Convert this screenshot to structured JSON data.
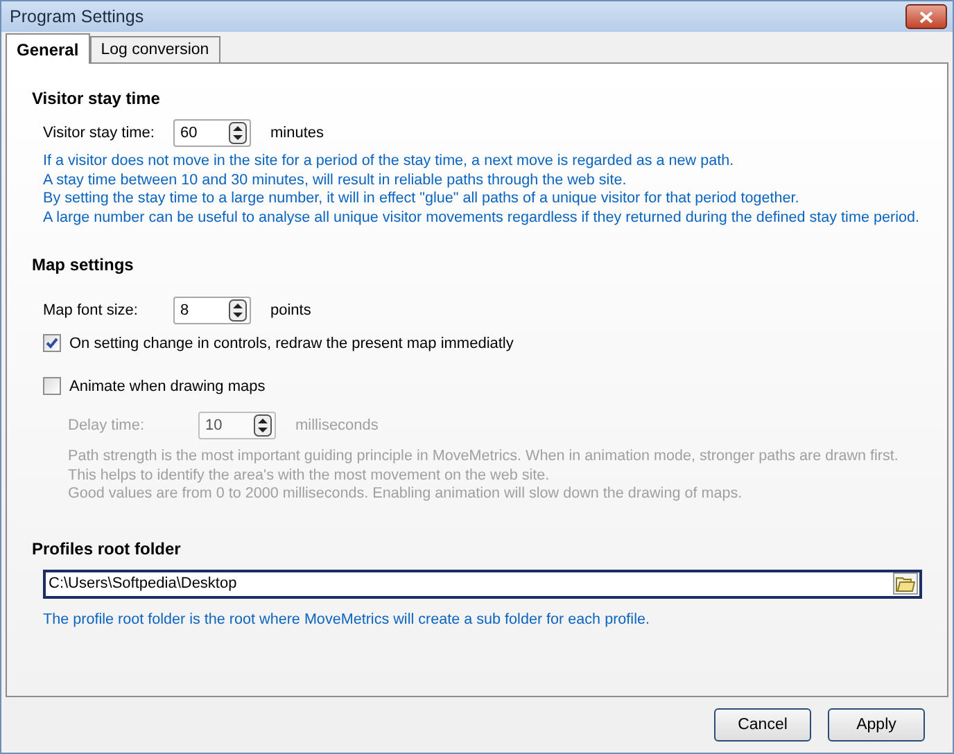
{
  "window": {
    "title": "Program Settings"
  },
  "tabs": [
    {
      "label": "General",
      "selected": true
    },
    {
      "label": "Log conversion",
      "selected": false
    }
  ],
  "visitor_stay_time": {
    "heading": "Visitor stay time",
    "field": {
      "label": "Visitor stay time:",
      "value": "60",
      "unit": "minutes"
    },
    "notes": [
      "If a visitor does not move in the site for a period of the stay time, a next move is regarded as a new path.",
      "A stay time between 10 and 30 minutes, will result in reliable paths through the web site.",
      "By setting the stay time to a large number, it will in effect \"glue\" all paths of a unique visitor for that period together.",
      "A large number can be useful to analyse all unique visitor movements regardless if they returned during the defined stay time period."
    ]
  },
  "map_settings": {
    "heading": "Map settings",
    "font_size": {
      "label": "Map font size:",
      "value": "8",
      "unit": "points"
    },
    "options": [
      {
        "label": "On setting change in controls, redraw the present map immediatly",
        "checked": true
      },
      {
        "label": "Animate when drawing maps",
        "checked": false
      }
    ],
    "delay": {
      "label": "Delay time:",
      "value": "10",
      "unit": "milliseconds",
      "disabled": true
    },
    "notes": [
      "Path strength is the most important guiding principle in MoveMetrics. When in animation mode, stronger paths are drawn first.",
      "This helps to identify the area's with the most movement on the web site.",
      "Good values are from 0 to 2000 milliseconds. Enabling animation will slow down the drawing of maps."
    ]
  },
  "profiles_root_folder": {
    "heading": "Profiles root folder",
    "value": "C:\\Users\\Softpedia\\Desktop",
    "note": "The profile root folder is the root where MoveMetrics will create a sub folder for each profile."
  },
  "buttons": [
    "Cancel",
    "Apply"
  ]
}
